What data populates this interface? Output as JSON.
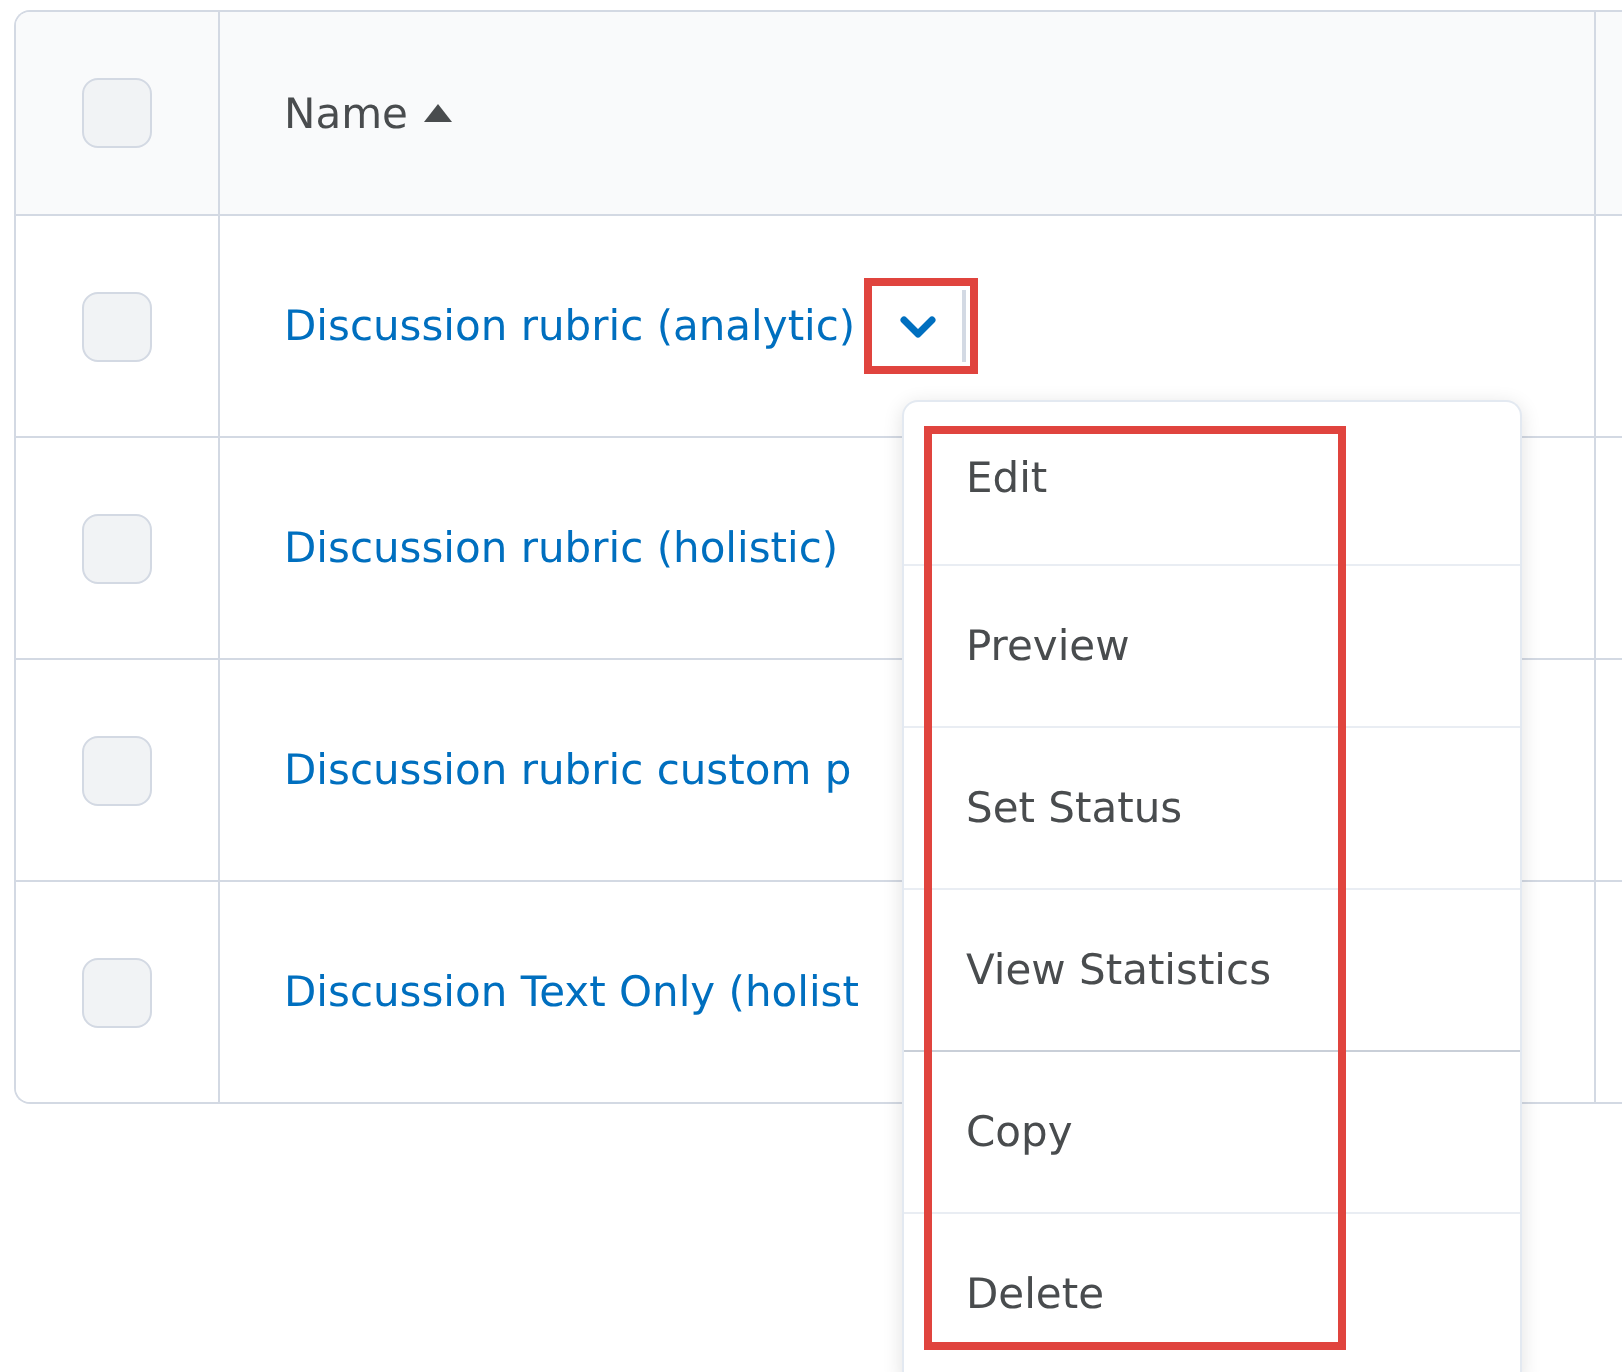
{
  "table": {
    "header": {
      "checked": false,
      "label": "Name"
    },
    "rows": [
      {
        "checked": false,
        "name": "Discussion rubric (analytic)",
        "menu_button": {
          "highlighted": true
        }
      },
      {
        "checked": false,
        "name": "Discussion rubric (holistic)"
      },
      {
        "checked": false,
        "name": "Discussion rubric custom p"
      },
      {
        "checked": false,
        "name": "Discussion Text Only (holist"
      }
    ]
  },
  "context_menu": {
    "highlighted": true,
    "items": [
      {
        "label": "Edit",
        "divider_above": false
      },
      {
        "label": "Preview",
        "divider_above": false
      },
      {
        "label": "Set Status",
        "divider_above": false
      },
      {
        "label": "View Statistics",
        "divider_above": false
      },
      {
        "label": "Copy",
        "divider_above": true
      },
      {
        "label": "Delete",
        "divider_above": false
      }
    ]
  }
}
